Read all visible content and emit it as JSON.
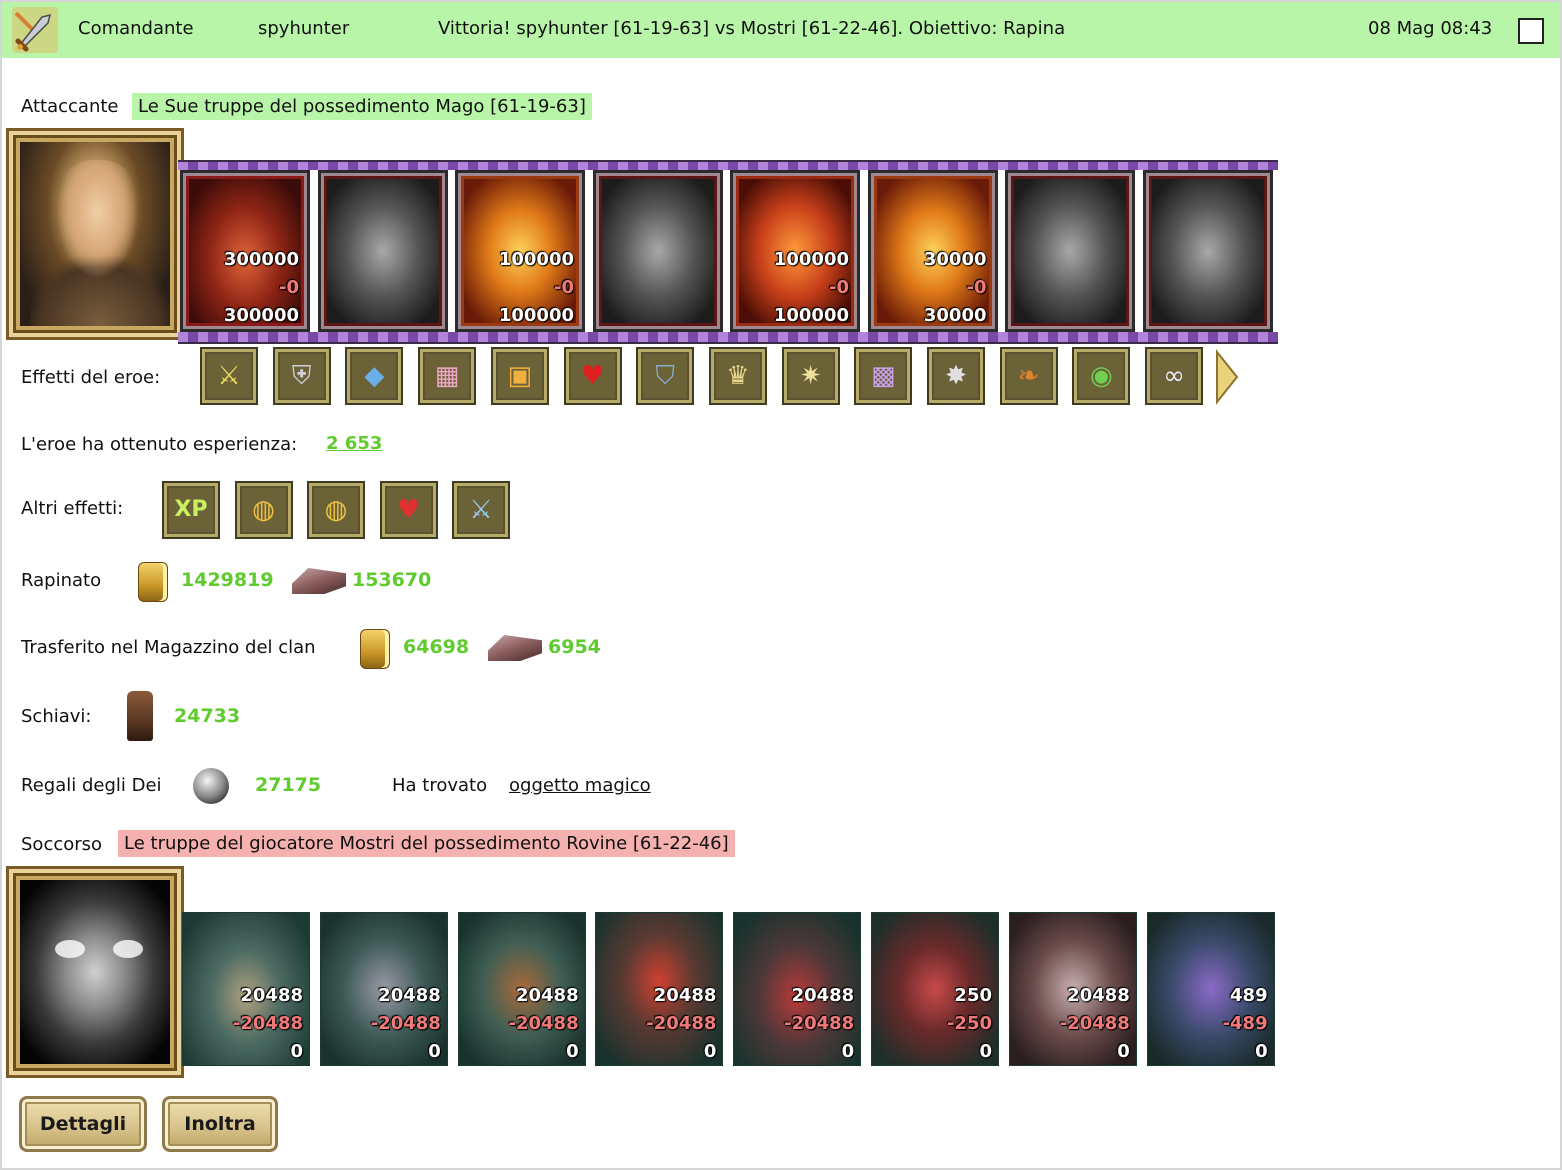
{
  "header": {
    "role": "Comandante",
    "user": "spyhunter",
    "message": "Vittoria! spyhunter [61-19-63] vs Mostri [61-22-46]. Obiettivo: Rapina",
    "datetime": "08 Mag 08:43",
    "bg_color": "#b9f5a8"
  },
  "attacker": {
    "label": "Attaccante",
    "description": "Le Sue truppe del possedimento Mago [61-19-63]",
    "units": [
      {
        "icon": "red-dragon",
        "tint": "red",
        "sent": "300000",
        "lost": "-0",
        "left": "300000"
      },
      {
        "icon": "skeleton-warrior",
        "tint": "gray",
        "sent": "",
        "lost": "",
        "left": ""
      },
      {
        "icon": "fire-lion",
        "tint": "gold",
        "sent": "100000",
        "lost": "-0",
        "left": "100000"
      },
      {
        "icon": "stone-gargoyle",
        "tint": "gray",
        "sent": "",
        "lost": "",
        "left": ""
      },
      {
        "icon": "fire-golem",
        "tint": "orange",
        "sent": "100000",
        "lost": "-0",
        "left": "100000"
      },
      {
        "icon": "flame-warrior",
        "tint": "gold",
        "sent": "30000",
        "lost": "-0",
        "left": "30000"
      },
      {
        "icon": "dark-knight",
        "tint": "gray",
        "sent": "",
        "lost": "",
        "left": ""
      },
      {
        "icon": "hooded-wraith",
        "tint": "gray",
        "sent": "",
        "lost": "",
        "left": ""
      }
    ]
  },
  "hero_effects": {
    "label": "Effetti del eroe:",
    "icons": [
      "sword-shield-icon",
      "armor-icon",
      "blue-crystal-icon",
      "pink-chest-icon",
      "treasure-chest-icon",
      "heart-icon",
      "shield-icon",
      "crown-icon",
      "star-amulet-icon",
      "armor-plate-icon",
      "spiked-amulet-icon",
      "horns-icon",
      "green-gem-ring-icon",
      "silver-chain-icon"
    ]
  },
  "experience": {
    "label": "L'eroe ha ottenuto esperienza:",
    "value": "2 653"
  },
  "other_effects": {
    "label": "Altri effetti:",
    "icons": [
      "xp-icon",
      "gold-pouch-icon",
      "gold-pouch-icon",
      "heart-dagger-icon",
      "sword-icon"
    ]
  },
  "looted": {
    "label": "Rapinato",
    "gold": "1429819",
    "iron": "153670"
  },
  "clan_storage": {
    "label": "Trasferito nel Magazzino del clan",
    "gold": "64698",
    "iron": "6954"
  },
  "slaves": {
    "label": "Schiavi:",
    "value": "24733"
  },
  "gods_gifts": {
    "label": "Regali degli Dei",
    "value": "27175",
    "found_label": "Ha trovato",
    "found_item": "oggetto magico"
  },
  "defender": {
    "label": "Soccorso",
    "description": "Le truppe del giocatore Mostri del possedimento Rovine [61-22-46]",
    "units": [
      {
        "icon": "lizard-warrior",
        "sent": "20488",
        "lost": "-20488",
        "left": "0"
      },
      {
        "icon": "armored-golem",
        "sent": "20488",
        "lost": "-20488",
        "left": "0"
      },
      {
        "icon": "orc-spearman",
        "sent": "20488",
        "lost": "-20488",
        "left": "0"
      },
      {
        "icon": "red-demon",
        "sent": "20488",
        "lost": "-20488",
        "left": "0"
      },
      {
        "icon": "spider-beast",
        "sent": "20488",
        "lost": "-20488",
        "left": "0"
      },
      {
        "icon": "red-harpy",
        "sent": "250",
        "lost": "-250",
        "left": "0"
      },
      {
        "icon": "crystal-behemoth",
        "sent": "20488",
        "lost": "-20488",
        "left": "0"
      },
      {
        "icon": "naga-sorceress",
        "sent": "489",
        "lost": "-489",
        "left": "0"
      }
    ]
  },
  "buttons": {
    "details": "Dettagli",
    "forward": "Inoltra"
  },
  "colors": {
    "value_green": "#5fcb2f",
    "loss_red": "#f07a7a",
    "defender_highlight": "#f5b0b0"
  }
}
